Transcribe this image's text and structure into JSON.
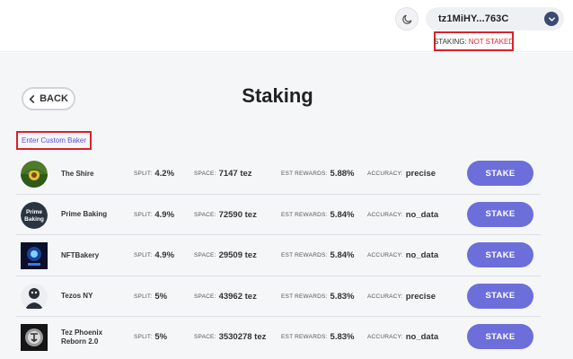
{
  "header": {
    "wallet_address": "tz1MiHY...763C",
    "staking_label": "STAKING:",
    "staking_value": "NOT STAKED",
    "theme_icon": "moon-icon",
    "chevron_icon": "chevron-down-icon"
  },
  "page": {
    "back_label": "BACK",
    "title": "Staking",
    "custom_baker_label": "Enter Custom Baker"
  },
  "labels": {
    "split": "SPLIT:",
    "space": "SPACE:",
    "rewards": "EST REWARDS:",
    "accuracy": "ACCURACY:",
    "stake": "STAKE"
  },
  "bakers": [
    {
      "name": "The Shire",
      "split": "4.2%",
      "space": "7147 tez",
      "rewards": "5.88%",
      "accuracy": "precise",
      "logo": "the-shire-logo"
    },
    {
      "name": "Prime Baking",
      "split": "4.9%",
      "space": "72590 tez",
      "rewards": "5.84%",
      "accuracy": "no_data",
      "logo": "prime-baking-logo",
      "logo_text_1": "Prime",
      "logo_text_2": "Baking"
    },
    {
      "name": "NFTBakery",
      "split": "4.9%",
      "space": "29509 tez",
      "rewards": "5.84%",
      "accuracy": "no_data",
      "logo": "nftbakery-logo"
    },
    {
      "name": "Tezos NY",
      "split": "5%",
      "space": "43962 tez",
      "rewards": "5.83%",
      "accuracy": "precise",
      "logo": "tezos-ny-logo"
    },
    {
      "name": "Tez Phoenix Reborn 2.0",
      "split": "5%",
      "space": "3530278 tez",
      "rewards": "5.83%",
      "accuracy": "no_data",
      "logo": "tez-phoenix-logo"
    }
  ],
  "colors": {
    "accent": "#6c6fd9",
    "alert": "#e3262f",
    "link": "#5a4fd8"
  }
}
